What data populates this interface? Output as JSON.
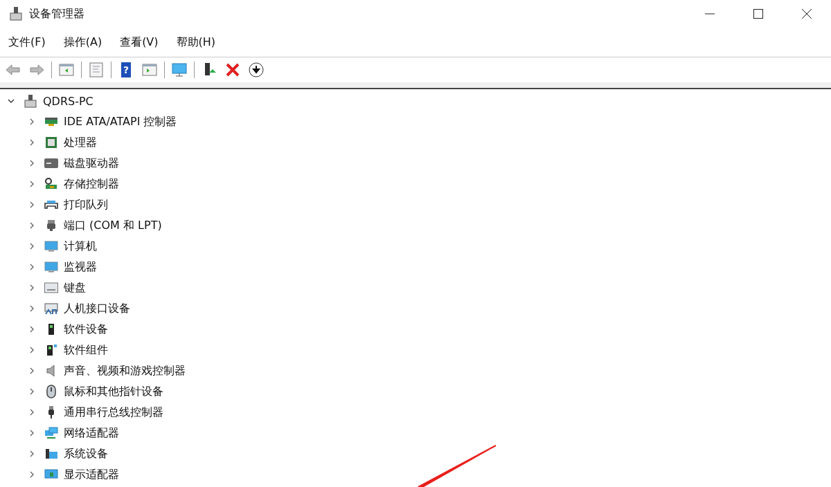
{
  "window": {
    "title": "设备管理器"
  },
  "toolbar": {
    "help_glyph": "?"
  },
  "menu": [
    "文件(F)",
    "操作(A)",
    "查看(V)",
    "帮助(H)"
  ],
  "tree": {
    "label": "QDRS-PC",
    "expanded": true,
    "children": [
      {
        "label": "IDE ATA/ATAPI 控制器",
        "expanded": false
      },
      {
        "label": "处理器",
        "expanded": false
      },
      {
        "label": "磁盘驱动器",
        "expanded": false
      },
      {
        "label": "存储控制器",
        "expanded": false
      },
      {
        "label": "打印队列",
        "expanded": false
      },
      {
        "label": "端口 (COM 和 LPT)",
        "expanded": false
      },
      {
        "label": "计算机",
        "expanded": false
      },
      {
        "label": "监视器",
        "expanded": false
      },
      {
        "label": "键盘",
        "expanded": false
      },
      {
        "label": "人机接口设备",
        "expanded": false
      },
      {
        "label": "软件设备",
        "expanded": false
      },
      {
        "label": "软件组件",
        "expanded": false
      },
      {
        "label": "声音、视频和游戏控制器",
        "expanded": false
      },
      {
        "label": "鼠标和其他指针设备",
        "expanded": false
      },
      {
        "label": "通用串行总线控制器",
        "expanded": false
      },
      {
        "label": "网络适配器",
        "expanded": false
      },
      {
        "label": "系统设备",
        "expanded": false
      },
      {
        "label": "显示适配器",
        "expanded": false
      }
    ]
  }
}
